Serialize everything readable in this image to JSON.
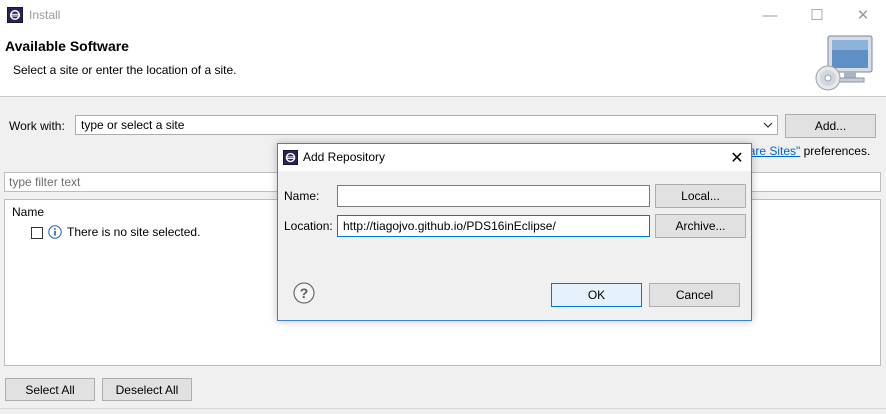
{
  "window": {
    "title": "Install",
    "minimize_symbol": "—",
    "maximize_symbol": "☐",
    "close_symbol": "✕"
  },
  "banner": {
    "title": "Available Software",
    "description": "Select a site or enter the location of a site."
  },
  "work_with": {
    "label": "Work with:",
    "value": "type or select a site",
    "add_button": "Add..."
  },
  "preferences_line": {
    "link_fragment": "ware Sites\"",
    "suffix": " preferences."
  },
  "filter": {
    "placeholder": "type filter text"
  },
  "tree": {
    "column_header": "Name",
    "empty_message": "There is no site selected."
  },
  "buttons": {
    "select_all": "Select All",
    "deselect_all": "Deselect All"
  },
  "dialog": {
    "title": "Add Repository",
    "close_symbol": "✕",
    "name_label": "Name:",
    "name_value": "",
    "location_label": "Location:",
    "location_value": "http://tiagojvo.github.io/PDS16inEclipse/",
    "local_button": "Local...",
    "archive_button": "Archive...",
    "help_symbol": "?",
    "ok_button": "OK",
    "cancel_button": "Cancel"
  },
  "colors": {
    "accent": "#0078d7",
    "dialog_border": "#3c84c6",
    "link": "#0066cc"
  },
  "icons": [
    "eclipse-app-icon",
    "monitor-cd-icon",
    "chevron-down-icon",
    "info-icon",
    "help-icon"
  ]
}
